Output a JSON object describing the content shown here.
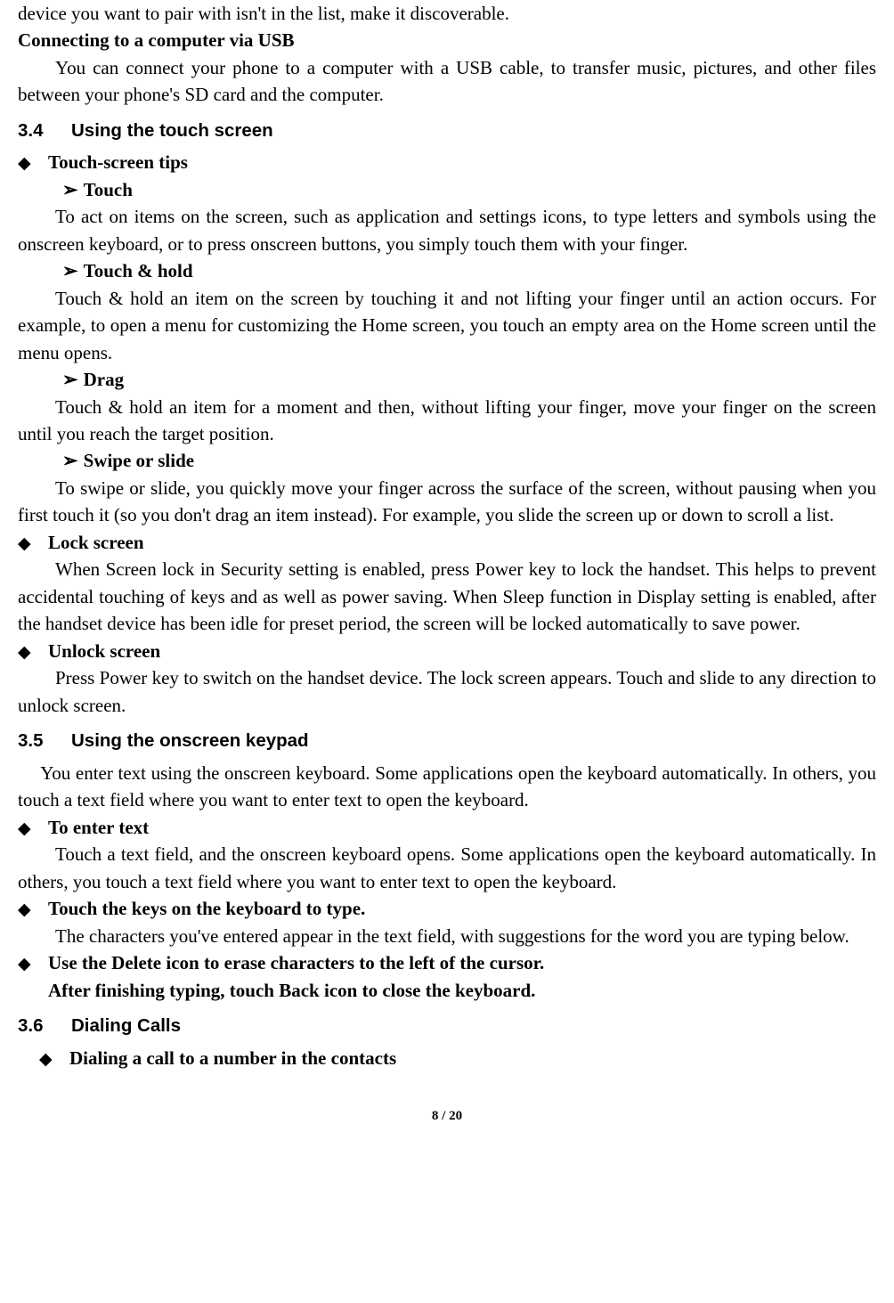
{
  "top": {
    "line1": "device you want to pair with isn't in the list, make it discoverable.",
    "usb_h": "Connecting to a computer via USB",
    "usb_p": "You can connect your phone to a computer with a USB cable, to transfer music, pictures, and other files between your phone's SD card and the computer."
  },
  "s34": {
    "num": "3.4",
    "title": "Using the touch screen",
    "d1_label": "Touch-screen tips",
    "a1_label": "Touch",
    "a1_p": "To act on items on the screen, such as application and settings icons, to type letters and symbols using the onscreen keyboard, or to press onscreen buttons, you simply touch them with your finger.",
    "a2_label": "Touch & hold",
    "a2_p": "Touch & hold an item on the screen by touching it and not lifting your finger until an action occurs. For example, to open a menu for customizing the Home screen, you touch an empty area on the Home screen until the menu opens.",
    "a3_label": "Drag",
    "a3_p": "Touch & hold an item for a moment and then, without lifting your finger, move your finger on the screen until you reach the target position.",
    "a4_label": "Swipe or slide",
    "a4_p": "To swipe or slide, you quickly move your finger across the surface of the screen, without pausing when you first touch it (so you don't drag an item instead). For example, you slide the screen up or down to scroll a list.",
    "d2_label": "Lock screen",
    "d2_p": "When Screen lock in Security setting is enabled, press Power key to lock the handset. This helps to prevent accidental touching of keys and as well as power saving. When Sleep function in Display setting is enabled, after the handset device has been idle for preset period, the screen will be locked automatically to save power.",
    "d3_label": "Unlock screen",
    "d3_p": "Press Power key to switch on the handset device. The lock screen appears. Touch and slide to any direction to unlock screen."
  },
  "s35": {
    "num": "3.5",
    "title": "Using the onscreen keypad",
    "intro": "You enter text using the onscreen keyboard. Some applications open the keyboard automatically. In others, you touch a text field where you want to enter text to open the keyboard.",
    "d1_label": "To enter text",
    "d1_p": "Touch a text field, and the onscreen keyboard opens. Some applications open the keyboard automatically. In others, you touch a text field where you want to enter text to open the keyboard.",
    "d2_label": "Touch the keys on the keyboard to type.",
    "d2_p": "The characters you've entered appear in the text field, with suggestions for the word you are typing below.",
    "d3_label": "Use the Delete icon to erase characters to the left of the cursor.",
    "d3_follow": "After finishing typing, touch Back icon to close the keyboard."
  },
  "s36": {
    "num": "3.6",
    "title": "Dialing Calls",
    "d1_label": "Dialing a call to a number in the contacts"
  },
  "footer": {
    "page": "8",
    "sep": " / ",
    "total": "20"
  }
}
